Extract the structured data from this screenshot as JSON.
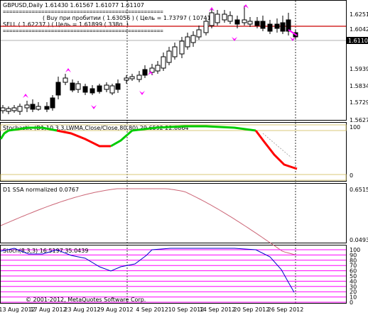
{
  "main": {
    "header": "GBPUSD,Daily  1.61430 1.61567 1.61077 1.61107",
    "separator": "==================================================",
    "buy_line": "( Buy при пробитии ( 1.63056 )  ( Цель = 1.73797 ( 10741п. )",
    "sell_line": "SELL  ( 1.62237 )  ( Цель = 1.61899 ( 338п. )",
    "price_labels": [
      "1.62515",
      "1.60420",
      "1.59390",
      "1.58345",
      "1.57290",
      "1.56270"
    ],
    "current_price": "1.61107"
  },
  "stochastic_panel": {
    "label": "Stochastic (D1,10,3,3,LWMA,Close/Close,80,80)  29.6592  22.8864",
    "scale": [
      "100",
      "0"
    ]
  },
  "ssa_panel": {
    "label": "D1 SSA normalized  0.0767",
    "scale": [
      "0.6515",
      "0.0493"
    ]
  },
  "stoch_panel": {
    "label": "Stoch(8,3,3)  16.5197  35.0439",
    "scale": [
      "100",
      "90",
      "80",
      "70",
      "60",
      "50",
      "40",
      "30",
      "20",
      "10",
      "0"
    ],
    "copyright": "© 2001-2012, MetaQuotes Software Corp."
  },
  "time_axis": [
    "13 Aug 2012",
    "17 Aug 2012",
    "23 Aug 2012",
    "29 Aug 2012",
    "4 Sep 2012",
    "10 Sep 2012",
    "14 Sep 2012",
    "20 Sep 2012",
    "26 Sep 2012"
  ],
  "colors": {
    "accent_pink": "#ff00ff",
    "level_red": "#cc0000",
    "stoch_red": "#ff0000",
    "stoch_green": "#00cc00",
    "ssa_line": "#cc6677",
    "stoch_line": "#0000cc"
  }
}
